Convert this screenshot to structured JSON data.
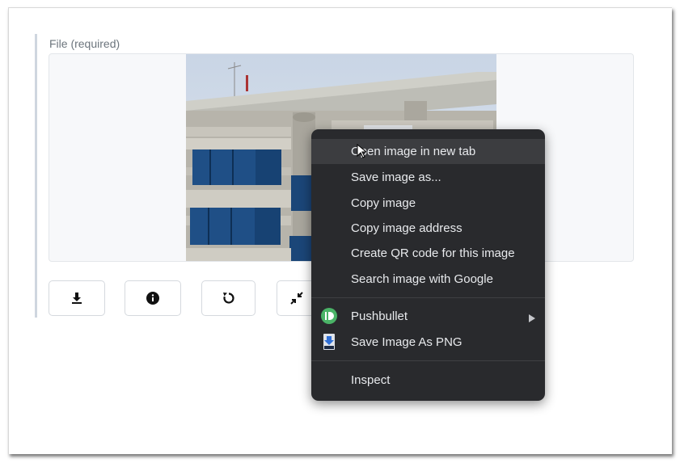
{
  "form": {
    "file_label": "File (required)"
  },
  "toolbar": {
    "buttons": [
      {
        "icon": "download-icon"
      },
      {
        "icon": "info-icon"
      },
      {
        "icon": "rotate-icon"
      },
      {
        "icon": "collapse-icon"
      }
    ]
  },
  "context_menu": {
    "items": [
      {
        "label": "Open image in new tab",
        "hovered": true
      },
      {
        "label": "Save image as..."
      },
      {
        "label": "Copy image"
      },
      {
        "label": "Copy image address"
      },
      {
        "label": "Create QR code for this image"
      },
      {
        "label": "Search image with Google"
      },
      {
        "label": "Pushbullet",
        "icon": "pushbullet-icon",
        "has_submenu": true
      },
      {
        "label": "Save Image As PNG",
        "icon": "png-icon"
      },
      {
        "label": "Inspect"
      }
    ]
  },
  "colors": {
    "menu_bg": "#292a2d",
    "menu_hover": "#3c3d40",
    "menu_text": "#e8eaed",
    "pushbullet_green": "#4ab367",
    "label_gray": "#6c757d"
  }
}
